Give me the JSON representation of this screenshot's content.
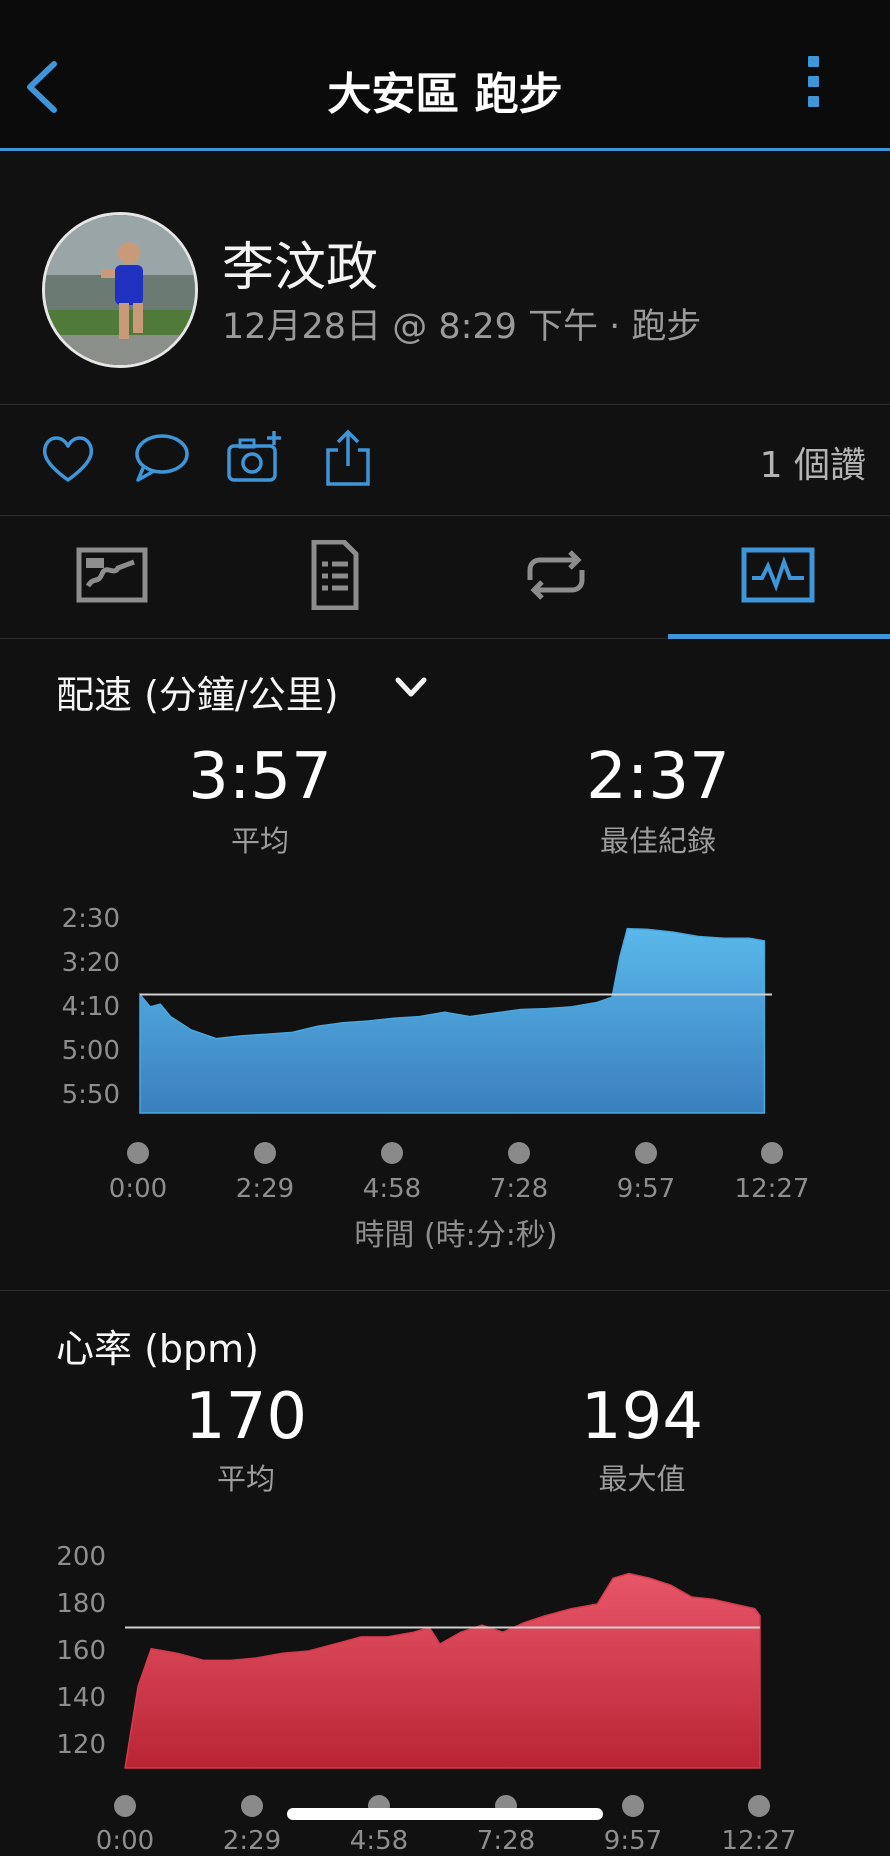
{
  "header": {
    "title": "大安區 跑步",
    "back_icon": "chevron-left-icon",
    "more_icon": "more-vertical-icon",
    "accent_color": "#3e95d8"
  },
  "activity": {
    "user_name": "李汶政",
    "meta": "12月28日 @ 8:29 下午 · 跑步",
    "likes": "1 個讚"
  },
  "actions": [
    "heart-icon",
    "comment-icon",
    "add-photo-icon",
    "share-icon"
  ],
  "tabs": [
    "map-tab",
    "details-tab",
    "laps-tab",
    "charts-tab"
  ],
  "pace": {
    "title": "配速 (分鐘/公里)",
    "avg_value": "3:57",
    "avg_label": "平均",
    "best_value": "2:37",
    "best_label": "最佳紀錄",
    "x_title": "時間 (時:分:秒)"
  },
  "heart_rate": {
    "title": "心率 (bpm)",
    "avg_value": "170",
    "avg_label": "平均",
    "max_value": "194",
    "max_label": "最大值"
  },
  "chart_data": [
    {
      "type": "area",
      "title": "配速 (分鐘/公里)",
      "xlabel": "時間 (時:分:秒)",
      "x_ticks": [
        "0:00",
        "2:29",
        "4:58",
        "7:28",
        "9:57",
        "12:27"
      ],
      "y_ticks": [
        "2:30",
        "3:20",
        "4:10",
        "5:00",
        "5:50"
      ],
      "y_axis_inverted": true,
      "ylim_sec": [
        150,
        380
      ],
      "average_line_sec": 237,
      "color": "#4aa7e0",
      "series": [
        {
          "x_min": [
            0,
            0.2,
            0.4,
            0.6,
            1.0,
            1.5,
            2.0,
            2.5,
            3.0,
            3.5,
            4.0,
            4.5,
            5.0,
            5.5,
            6.0,
            6.5,
            7.0,
            7.5,
            8.0,
            8.5,
            9.0,
            9.3,
            9.45,
            9.6,
            10.0,
            10.5,
            11.0,
            11.5,
            12.0,
            12.3
          ],
          "pace_sec": [
            237,
            251,
            248,
            262,
            277,
            287,
            284,
            282,
            280,
            273,
            269,
            267,
            264,
            262,
            257,
            262,
            258,
            254,
            253,
            251,
            246,
            240,
            195,
            162,
            163,
            166,
            171,
            173,
            173,
            176
          ]
        }
      ]
    },
    {
      "type": "area",
      "title": "心率 (bpm)",
      "x_ticks": [
        "0:00",
        "2:29",
        "4:58",
        "7:28",
        "9:57",
        "12:27"
      ],
      "y_ticks": [
        "200",
        "180",
        "160",
        "140",
        "120"
      ],
      "ylim": [
        110,
        200
      ],
      "average_line": 170,
      "color": "#d5394a",
      "series": [
        {
          "x_min": [
            0,
            0.25,
            0.5,
            1.0,
            1.5,
            2.0,
            2.5,
            3.0,
            3.5,
            4.0,
            4.5,
            5.0,
            5.5,
            5.8,
            6.0,
            6.4,
            6.8,
            7.2,
            7.6,
            8.0,
            8.5,
            9.0,
            9.3,
            9.6,
            10.0,
            10.4,
            10.8,
            11.2,
            11.6,
            12.0,
            12.1
          ],
          "bpm": [
            110,
            145,
            161,
            159,
            156,
            156,
            157,
            159,
            160,
            163,
            166,
            166,
            168,
            170,
            163,
            168,
            171,
            168,
            172,
            175,
            178,
            180,
            191,
            193,
            191,
            188,
            183,
            182,
            180,
            178,
            175
          ]
        }
      ]
    }
  ]
}
